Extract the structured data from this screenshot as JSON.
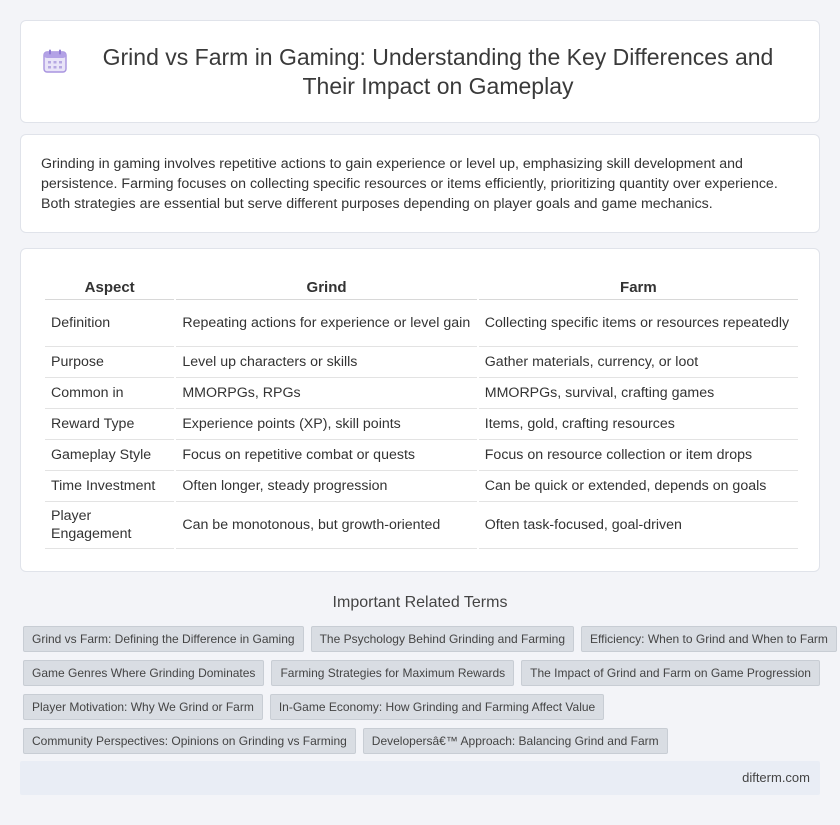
{
  "header": {
    "icon": "calendar-icon",
    "title": "Grind vs Farm in Gaming: Understanding the Key Differences and Their Impact on Gameplay"
  },
  "intro": {
    "text": "Grinding in gaming involves repetitive actions to gain experience or level up, emphasizing skill development and persistence. Farming focuses on collecting specific resources or items efficiently, prioritizing quantity over experience. Both strategies are essential but serve different purposes depending on player goals and game mechanics."
  },
  "table": {
    "headers": [
      "Aspect",
      "Grind",
      "Farm"
    ],
    "rows": [
      [
        "Definition",
        "Repeating actions for experience or level gain",
        "Collecting specific items or resources repeatedly"
      ],
      [
        "Purpose",
        "Level up characters or skills",
        "Gather materials, currency, or loot"
      ],
      [
        "Common in",
        "MMORPGs, RPGs",
        "MMORPGs, survival, crafting games"
      ],
      [
        "Reward Type",
        "Experience points (XP), skill points",
        "Items, gold, crafting resources"
      ],
      [
        "Gameplay Style",
        "Focus on repetitive combat or quests",
        "Focus on resource collection or item drops"
      ],
      [
        "Time Investment",
        "Often longer, steady progression",
        "Can be quick or extended, depends on goals"
      ],
      [
        "Player Engagement",
        "Can be monotonous, but growth-oriented",
        "Often task-focused, goal-driven"
      ]
    ]
  },
  "related": {
    "title": "Important Related Terms",
    "tags": [
      [
        "Grind vs Farm: Defining the Difference in Gaming",
        "The Psychology Behind Grinding and Farming",
        "Efficiency: When to Grind and When to Farm"
      ],
      [
        "Game Genres Where Grinding Dominates",
        "Farming Strategies for Maximum Rewards",
        "The Impact of Grind and Farm on Game Progression"
      ],
      [
        "Player Motivation: Why We Grind or Farm",
        "In-Game Economy: How Grinding and Farming Affect Value"
      ],
      [
        "Community Perspectives: Opinions on Grinding vs Farming",
        "Developersâ€™ Approach: Balancing Grind and Farm"
      ]
    ]
  },
  "footer": {
    "site": "difterm.com"
  },
  "colors": {
    "background": "#f3f4f8",
    "tag_bg": "#d9dde3",
    "footer_bg": "#e9edf5",
    "icon": "#9a86d8"
  }
}
